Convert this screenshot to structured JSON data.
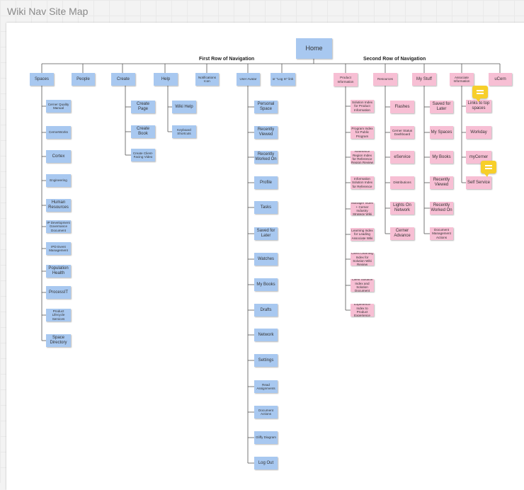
{
  "app_title": "Wiki Nav Site Map",
  "home": "Home",
  "row1_label": "First Row of Navigation",
  "row2_label": "Second Row of Navigation",
  "level1": {
    "spaces": "Spaces",
    "people": "People",
    "create": "Create",
    "help": "Help",
    "notifications": "Notifications Icon",
    "user_avatar": "User Avatar",
    "login_link": "or \"Log In\" link",
    "product_info": "Product Information",
    "resources": "Resources",
    "my_stuff": "My Stuff",
    "associate_info": "Associate Information",
    "ucern": "uCern"
  },
  "spaces_children": [
    "Cerner Quality Manual",
    "CernerWorks",
    "Cortex",
    "Engineering",
    "Human Resources",
    "IP Development Governance Document",
    "IPD Event Management",
    "Population Health",
    "ProcessIT",
    "Product Lifecycle Services",
    "Space Directory"
  ],
  "create_children": [
    "Create Page",
    "Create Book",
    "Create Client-Facing Video"
  ],
  "help_children": [
    "Wiki Help",
    "Keyboard Shortcuts"
  ],
  "user_children": [
    "Personal Space",
    "Recently Viewed",
    "Recently Worked On",
    "Profile",
    "Tasks",
    "Saved for Later",
    "Watches",
    "My Books",
    "Drafts",
    "Network",
    "Settings",
    "Read Assignments",
    "Document Actions",
    "Gliffy Diagram",
    "Log Out"
  ],
  "product_children": [
    "Solution Index for Product Information",
    "Public Program Index for Public Program Review",
    "Reference Region Index for Reference Region Review",
    "Reference Information Solution Index for Reference Pathways",
    "Product Manager Index + Cerner Industry Strategy Wiki Review",
    "Associate Learning Index for Leading Associate Wiki Review",
    "Client Learning Index for Solution Wiki Review",
    "Client Solution Index and Solution Document",
    "Client Experience Index to Product Experience Wiki"
  ],
  "resources_children": [
    "Flashes",
    "Cerner Status Dashboard",
    "eService",
    "Distributions",
    "Lights On Network",
    "Cerner Advance"
  ],
  "mystuff_children": [
    "Saved for Later",
    "My Spaces",
    "My Books",
    "Recently Viewed",
    "Recently Worked On",
    "Document Management Actions"
  ],
  "associate_children": [
    "Links to top spaces",
    "Workday",
    "myCerner",
    "Self Service"
  ],
  "colors": {
    "blue_note": "#a8c8f0",
    "pink_note": "#f7bfd4",
    "comment": "#f7cf2a",
    "line": "#555555"
  }
}
